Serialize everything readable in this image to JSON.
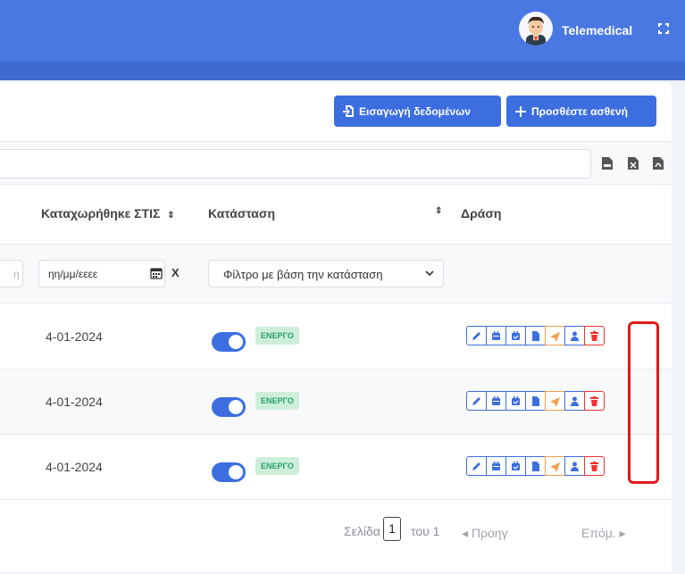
{
  "header": {
    "brand": "Telemedical"
  },
  "toolbar": {
    "import_label": "Εισαγωγή δεδομένων",
    "add_label": "Προσθέστε ασθενή"
  },
  "table": {
    "headers": {
      "registered": "Καταχωρήθηκε ΣΤΙΣ",
      "status": "Κατάσταση",
      "action": "Δράση"
    },
    "filters": {
      "text_stub": "η",
      "date_placeholder": "ηη/μμ/εεεε",
      "clear": "X",
      "status_placeholder": "Φίλτρο με βάση την κατάσταση"
    },
    "rows": [
      {
        "date": "4-01-2024",
        "status": "ΕΝΕΡΓΟ"
      },
      {
        "date": "4-01-2024",
        "status": "ΕΝΕΡΓΟ"
      },
      {
        "date": "4-01-2024",
        "status": "ΕΝΕΡΓΟ"
      }
    ]
  },
  "pagination": {
    "page_label": "Σελίδα",
    "current": "1",
    "of_label": "του 1",
    "prev": "◂ Προηγ",
    "next": "Επόμ. ▸"
  },
  "colors": {
    "primary": "#3c6ee0",
    "topbar": "#4a78e2",
    "badge_bg": "#cdeedb",
    "badge_text": "#27a163",
    "danger": "#e33333",
    "send": "#f0a04b"
  }
}
